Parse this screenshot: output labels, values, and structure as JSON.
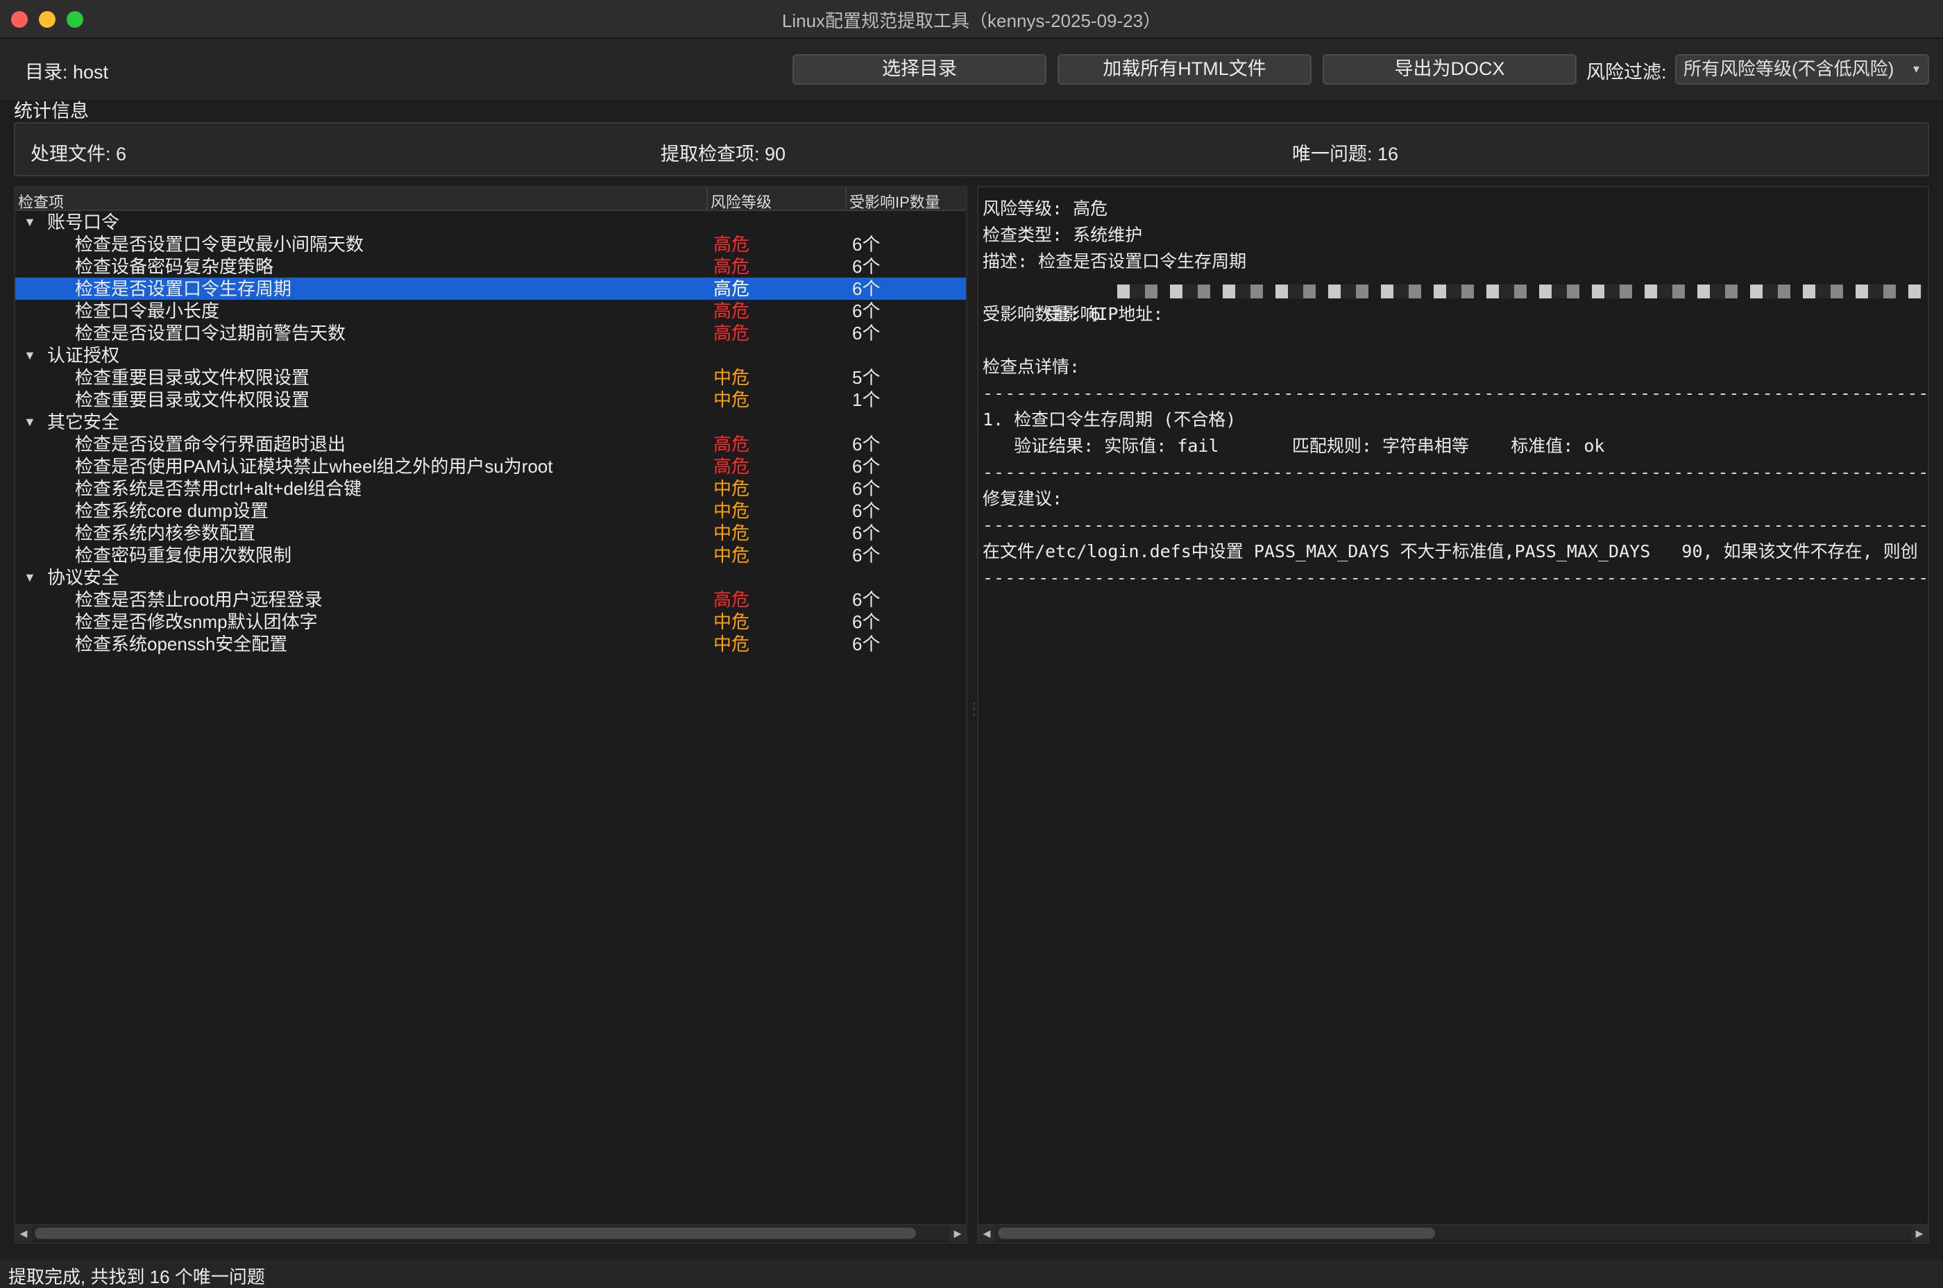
{
  "window": {
    "title": "Linux配置规范提取工具（kennys-2025-09-23）"
  },
  "toolbar": {
    "dir_label": "目录: host",
    "select_dir": "选择目录",
    "load_html": "加载所有HTML文件",
    "export_docx": "导出为DOCX",
    "filter_label": "风险过滤:",
    "filter_value": "所有风险等级(不含低风险)"
  },
  "stats": {
    "title": "统计信息",
    "files": "处理文件: 6",
    "checks": "提取检查项: 90",
    "unique": "唯一问题: 16"
  },
  "tree": {
    "headers": {
      "name": "检查项",
      "risk": "风险等级",
      "count": "受影响IP数量"
    },
    "categories": [
      {
        "label": "账号口令",
        "items": [
          {
            "name": "检查是否设置口令更改最小间隔天数",
            "risk": "高危",
            "count": "6个"
          },
          {
            "name": "检查设备密码复杂度策略",
            "risk": "高危",
            "count": "6个"
          },
          {
            "name": "检查是否设置口令生存周期",
            "risk": "高危",
            "count": "6个"
          },
          {
            "name": "检查口令最小长度",
            "risk": "高危",
            "count": "6个"
          },
          {
            "name": "检查是否设置口令过期前警告天数",
            "risk": "高危",
            "count": "6个"
          }
        ]
      },
      {
        "label": "认证授权",
        "items": [
          {
            "name": "检查重要目录或文件权限设置",
            "risk": "中危",
            "count": "5个"
          },
          {
            "name": "检查重要目录或文件权限设置",
            "risk": "中危",
            "count": "1个"
          }
        ]
      },
      {
        "label": "其它安全",
        "items": [
          {
            "name": "检查是否设置命令行界面超时退出",
            "risk": "高危",
            "count": "6个"
          },
          {
            "name": "检查是否使用PAM认证模块禁止wheel组之外的用户su为root",
            "risk": "高危",
            "count": "6个"
          },
          {
            "name": "检查系统是否禁用ctrl+alt+del组合键",
            "risk": "中危",
            "count": "6个"
          },
          {
            "name": "检查系统core dump设置",
            "risk": "中危",
            "count": "6个"
          },
          {
            "name": "检查系统内核参数配置",
            "risk": "中危",
            "count": "6个"
          },
          {
            "name": "检查密码重复使用次数限制",
            "risk": "中危",
            "count": "6个"
          }
        ]
      },
      {
        "label": "协议安全",
        "items": [
          {
            "name": "检查是否禁止root用户远程登录",
            "risk": "高危",
            "count": "6个"
          },
          {
            "name": "检查是否修改snmp默认团体字",
            "risk": "中危",
            "count": "6个"
          },
          {
            "name": "检查系统openssh安全配置",
            "risk": "中危",
            "count": "6个"
          }
        ]
      }
    ]
  },
  "detail": {
    "risk": "风险等级: 高危",
    "type": "检查类型: 系统维护",
    "desc": "描述: 检查是否设置口令生存周期",
    "ip_label": "受影响IP地址:",
    "count": "受影响数量: 6",
    "points_title": "检查点详情:",
    "point1": "1. 检查口令生存周期 (不合格)",
    "point1_result": "   验证结果: 实际值: fail       匹配规则: 字符串相等    标准值: ok",
    "fix_title": "修复建议:",
    "fix_text": "在文件/etc/login.defs中设置 PASS_MAX_DAYS 不大于标准值,PASS_MAX_DAYS   90, 如果该文件不存在, 则创"
  },
  "status": {
    "text": "提取完成, 共找到 16 个唯一问题"
  },
  "colors": {
    "high": "#ff2a2a",
    "medium": "#ffa200",
    "selection": "#1a61d6"
  },
  "selected_item": "检查是否设置口令生存周期"
}
